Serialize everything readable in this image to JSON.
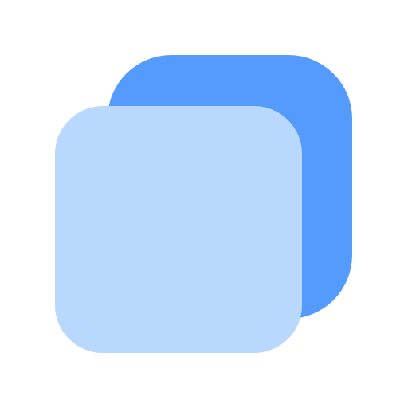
{
  "icon": {
    "name": "copy-icon",
    "colors": {
      "background": "#ffffff",
      "back_square": "#559bfd",
      "front_square": "#b9d8fe"
    }
  }
}
